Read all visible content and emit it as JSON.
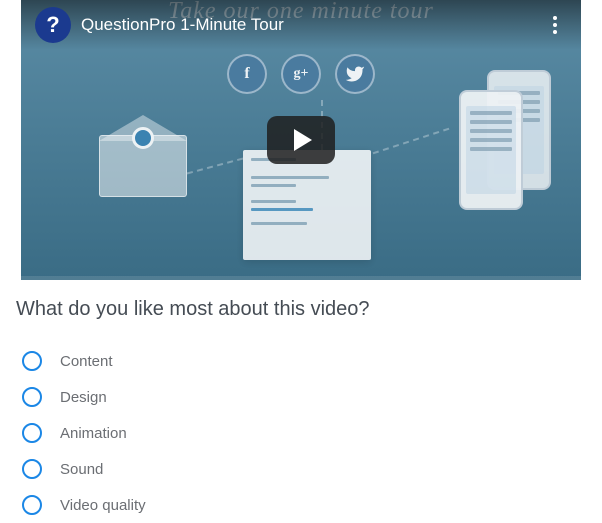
{
  "video": {
    "bg_heading": "Take our one minute tour",
    "title": "QuestionPro 1-Minute Tour",
    "favicon_letter": "?",
    "social": {
      "fb": "f",
      "gp": "g+",
      "tw": "t"
    }
  },
  "question": {
    "text": "What do you like most about this video?",
    "options": [
      "Content",
      "Design",
      "Animation",
      "Sound",
      "Video quality"
    ]
  }
}
